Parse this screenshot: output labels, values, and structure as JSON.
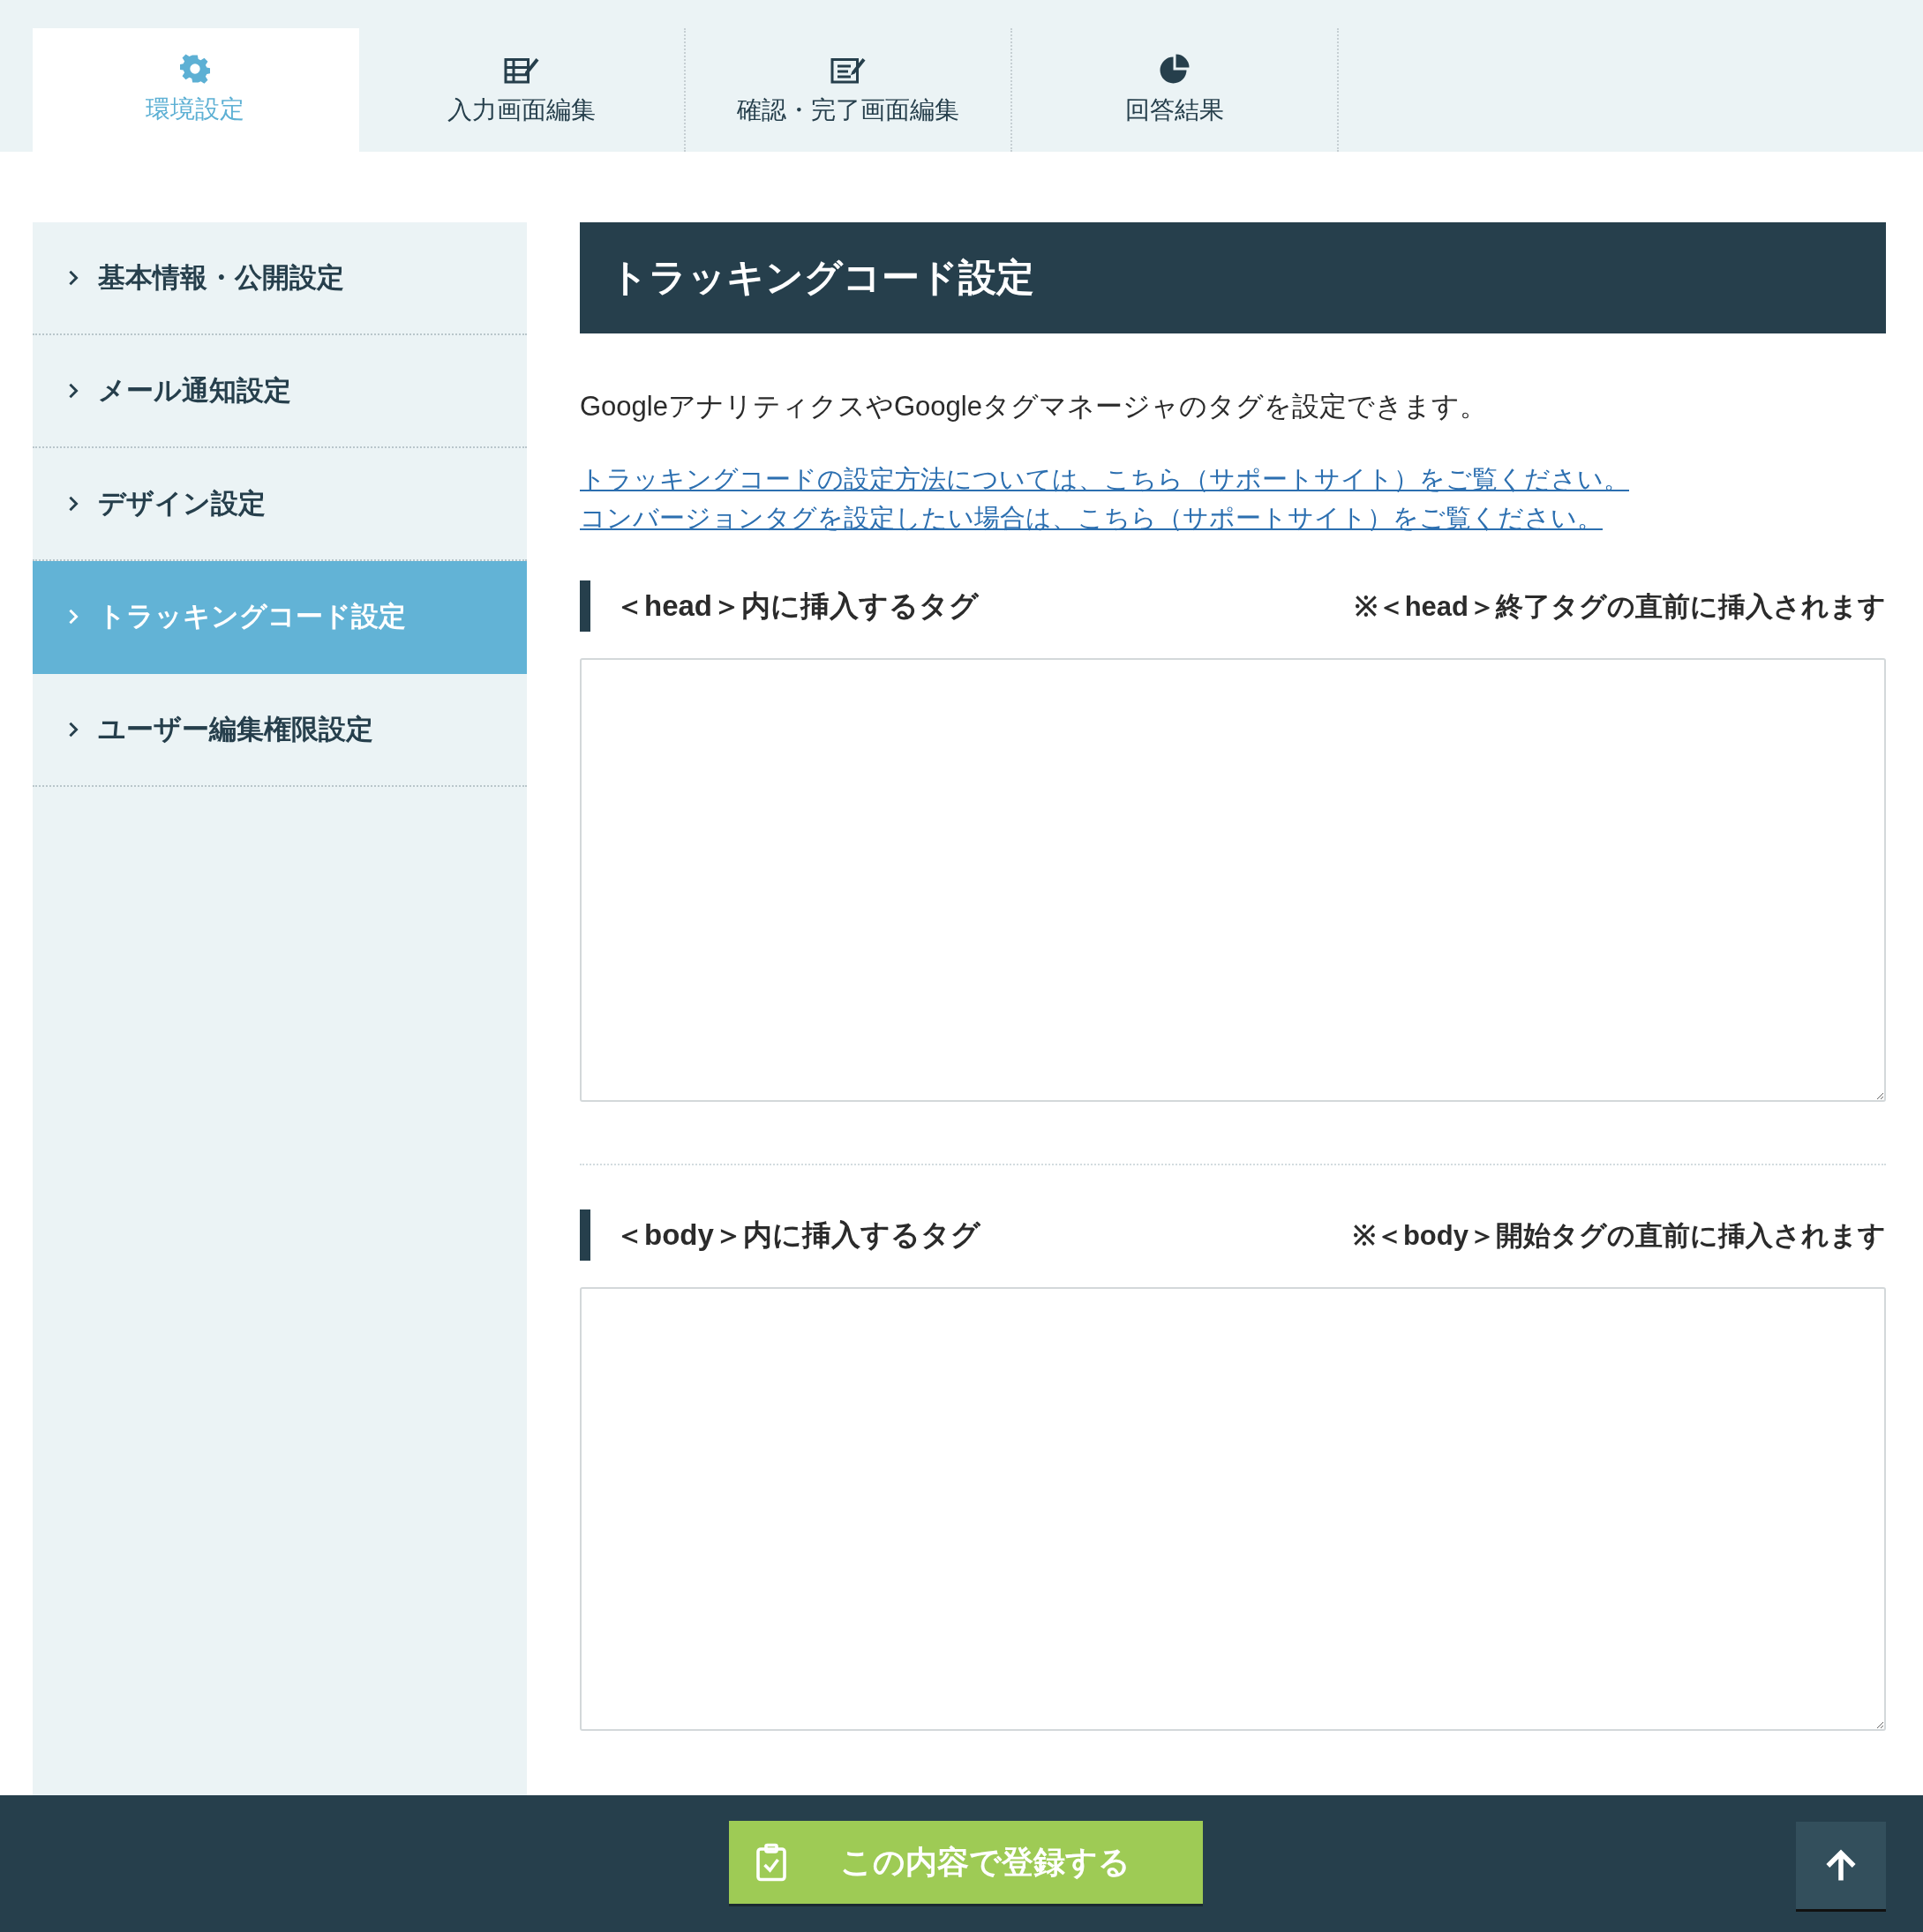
{
  "tabs": [
    {
      "label": "環境設定",
      "selected": true
    },
    {
      "label": "入力画面編集",
      "selected": false
    },
    {
      "label": "確認・完了画面編集",
      "selected": false
    },
    {
      "label": "回答結果",
      "selected": false
    }
  ],
  "sidebar": {
    "items": [
      {
        "label": "基本情報・公開設定",
        "selected": false
      },
      {
        "label": "メール通知設定",
        "selected": false
      },
      {
        "label": "デザイン設定",
        "selected": false
      },
      {
        "label": "トラッキングコード設定",
        "selected": true
      },
      {
        "label": "ユーザー編集権限設定",
        "selected": false
      }
    ]
  },
  "main": {
    "title": "トラッキングコード設定",
    "description": "GoogleアナリティクスやGoogleタグマネージャのタグを設定できます。",
    "links": [
      "トラッキングコードの設定方法については、こちら（サポートサイト）をご覧ください。",
      "コンバージョンタグを設定したい場合は、こちら（サポートサイト）をご覧ください。"
    ],
    "sections": [
      {
        "label": "＜head＞内に挿入するタグ",
        "note": "※＜head＞終了タグの直前に挿入されます"
      },
      {
        "label": "＜body＞内に挿入するタグ",
        "note": "※＜body＞開始タグの直前に挿入されます"
      }
    ]
  },
  "footer": {
    "submit_button": "この内容で登録する"
  }
}
